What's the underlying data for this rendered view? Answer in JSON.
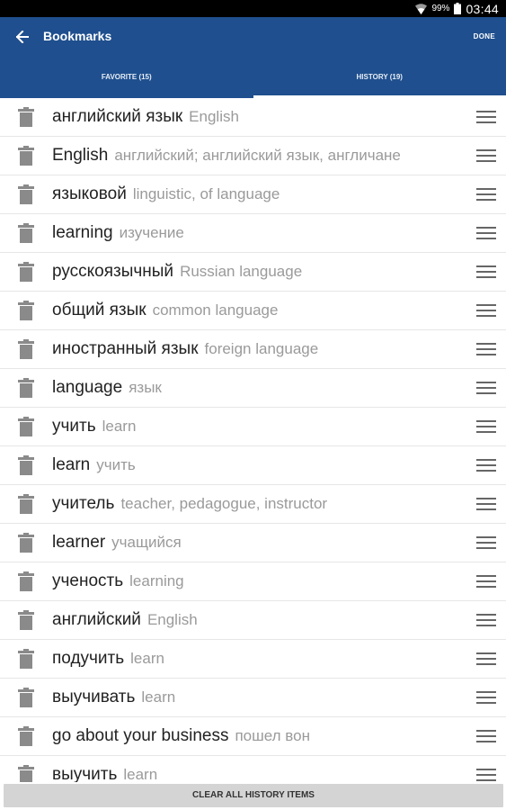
{
  "status_bar": {
    "battery": "99%",
    "time": "03:44",
    "icons": [
      "wifi-icon",
      "battery-icon"
    ]
  },
  "app_bar": {
    "back_icon": "arrow-left-icon",
    "title": "Bookmarks",
    "done_label": "DONE"
  },
  "tabs": [
    {
      "label": "FAVORITE (15)",
      "active": false
    },
    {
      "label": "HISTORY (19)",
      "active": true
    }
  ],
  "colors": {
    "app_bar": "#1f4f8e",
    "term_text": "#222222",
    "translation_text": "#9a9a9a",
    "icon_gray": "#8a8a8a",
    "footer_bg": "#d4d4d4"
  },
  "history": [
    {
      "term": "английский язык",
      "translation": "English"
    },
    {
      "term": "English",
      "translation": "английский; английский язык, англичане"
    },
    {
      "term": "языковой",
      "translation": "linguistic, of language"
    },
    {
      "term": "learning",
      "translation": "изучение"
    },
    {
      "term": "русскоязычный",
      "translation": "Russian language"
    },
    {
      "term": "общий язык",
      "translation": "common language"
    },
    {
      "term": "иностранный язык",
      "translation": "foreign language"
    },
    {
      "term": "language",
      "translation": "язык"
    },
    {
      "term": "учить",
      "translation": "learn"
    },
    {
      "term": "learn",
      "translation": "учить"
    },
    {
      "term": "учитель",
      "translation": "teacher, pedagogue, instructor"
    },
    {
      "term": "learner",
      "translation": "учащийся"
    },
    {
      "term": "ученость",
      "translation": "learning"
    },
    {
      "term": "английский",
      "translation": "English"
    },
    {
      "term": "подучить",
      "translation": "learn"
    },
    {
      "term": "выучивать",
      "translation": "learn"
    },
    {
      "term": "go about your business",
      "translation": "пошел вон"
    },
    {
      "term": "выучить",
      "translation": "learn"
    }
  ],
  "footer": {
    "clear_label": "CLEAR ALL HISTORY ITEMS"
  }
}
